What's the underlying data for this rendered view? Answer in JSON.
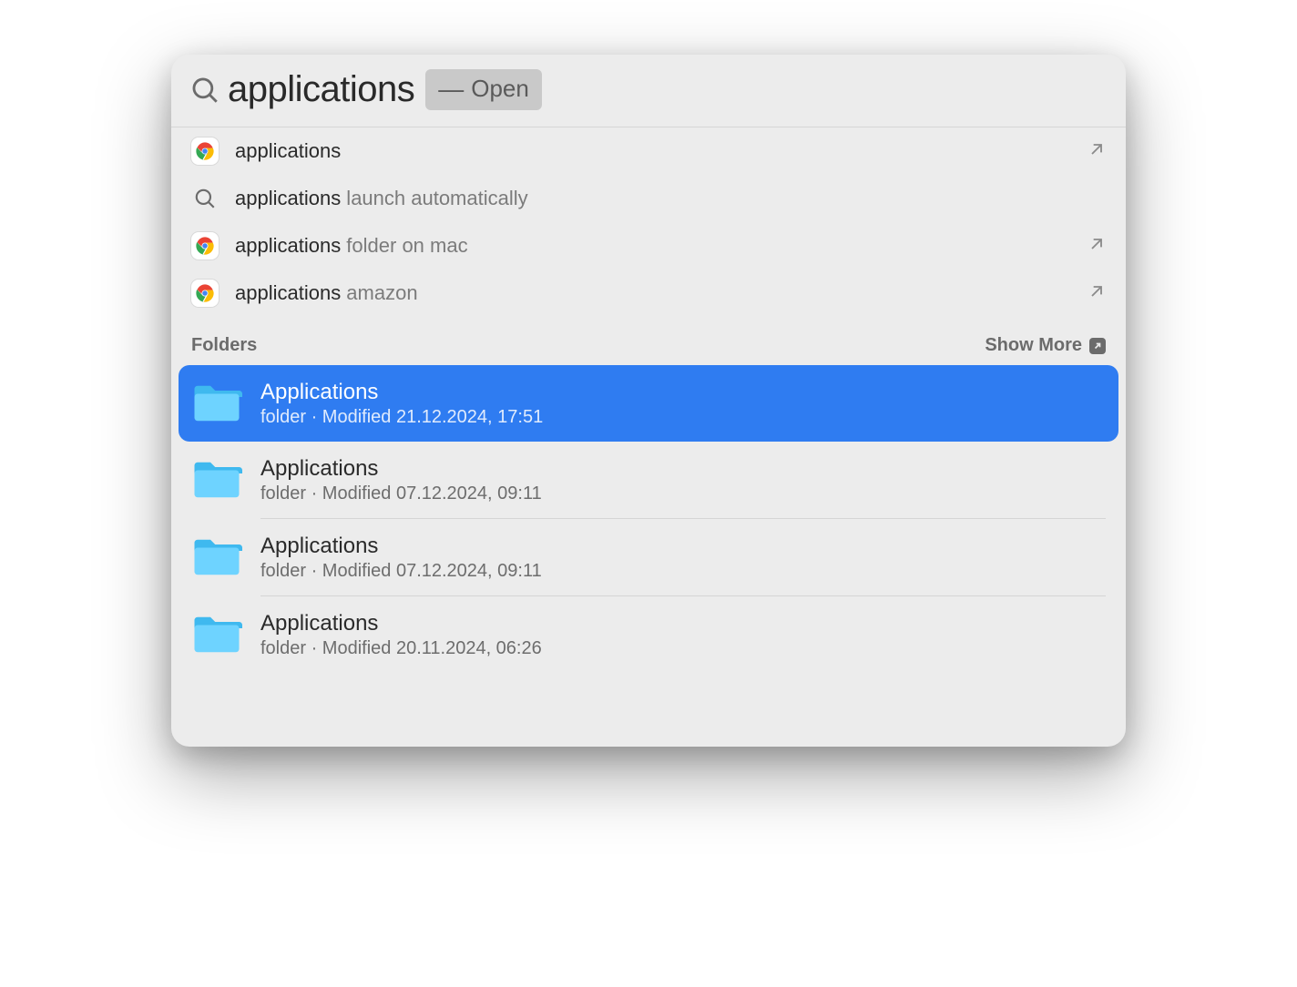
{
  "search": {
    "query": "applications",
    "hint_dash": "—",
    "hint_action": "Open"
  },
  "suggestions": [
    {
      "icon": "chrome",
      "term": "applications",
      "completion": "",
      "external": true
    },
    {
      "icon": "search",
      "term": "applications",
      "completion": " launch automatically",
      "external": false
    },
    {
      "icon": "chrome",
      "term": "applications",
      "completion": " folder on mac",
      "external": true
    },
    {
      "icon": "chrome",
      "term": "applications",
      "completion": " amazon",
      "external": true
    }
  ],
  "section": {
    "title": "Folders",
    "show_more": "Show More"
  },
  "folders": [
    {
      "name": "Applications",
      "meta": "folder · Modified 21.12.2024, 17:51",
      "selected": true
    },
    {
      "name": "Applications",
      "meta": "folder · Modified 07.12.2024, 09:11",
      "selected": false
    },
    {
      "name": "Applications",
      "meta": "folder · Modified 07.12.2024, 09:11",
      "selected": false
    },
    {
      "name": "Applications",
      "meta": "folder · Modified 20.11.2024, 06:26",
      "selected": false
    }
  ]
}
